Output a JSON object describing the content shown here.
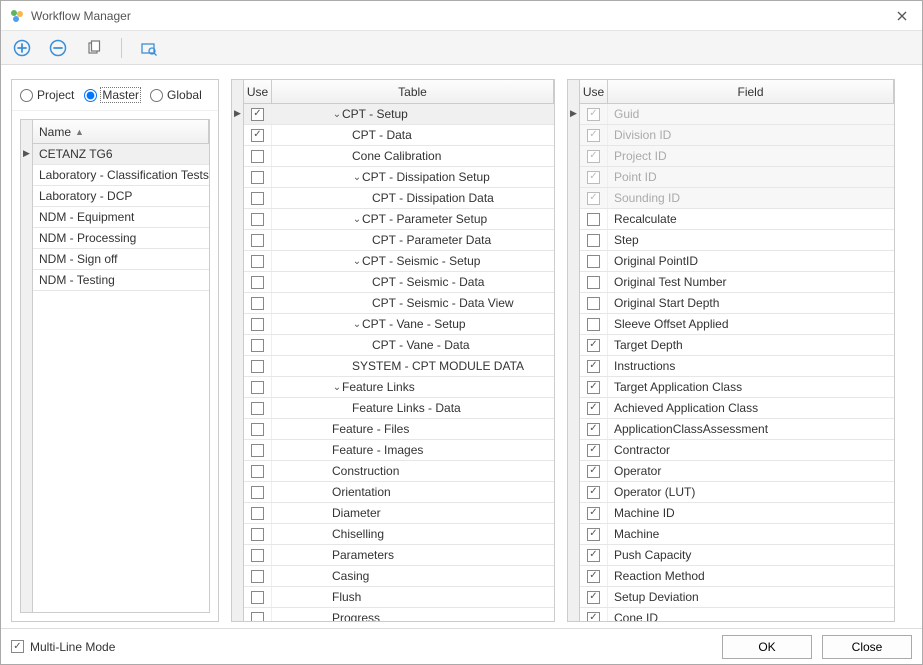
{
  "window": {
    "title": "Workflow Manager"
  },
  "toolbar": {
    "icons": [
      "add-icon",
      "remove-icon",
      "copy-icon",
      "inspect-icon"
    ]
  },
  "scope": {
    "options": [
      {
        "id": "project",
        "label": "Project",
        "checked": false
      },
      {
        "id": "master",
        "label": "Master",
        "checked": true
      },
      {
        "id": "global",
        "label": "Global",
        "checked": false
      }
    ]
  },
  "leftGrid": {
    "headers": {
      "name": "Name"
    },
    "rows": [
      {
        "name": "CETANZ TG6",
        "selected": true
      },
      {
        "name": "Laboratory - Classification Tests"
      },
      {
        "name": "Laboratory - DCP"
      },
      {
        "name": "NDM - Equipment"
      },
      {
        "name": "NDM - Processing"
      },
      {
        "name": "NDM - Sign off"
      },
      {
        "name": "NDM - Testing"
      }
    ]
  },
  "tableGrid": {
    "headers": {
      "use": "Use",
      "table": "Table"
    },
    "rows": [
      {
        "use": true,
        "label": "CPT - Setup",
        "indent": 0,
        "expand": true,
        "selected": true
      },
      {
        "use": true,
        "label": "CPT - Data",
        "indent": 1
      },
      {
        "use": false,
        "label": "Cone Calibration",
        "indent": 1
      },
      {
        "use": false,
        "label": "CPT - Dissipation Setup",
        "indent": 1,
        "expand": true
      },
      {
        "use": false,
        "label": "CPT - Dissipation Data",
        "indent": 2
      },
      {
        "use": false,
        "label": "CPT - Parameter Setup",
        "indent": 1,
        "expand": true
      },
      {
        "use": false,
        "label": "CPT - Parameter Data",
        "indent": 2
      },
      {
        "use": false,
        "label": "CPT - Seismic - Setup",
        "indent": 1,
        "expand": true
      },
      {
        "use": false,
        "label": "CPT - Seismic - Data",
        "indent": 2
      },
      {
        "use": false,
        "label": "CPT - Seismic - Data View",
        "indent": 2
      },
      {
        "use": false,
        "label": "CPT - Vane - Setup",
        "indent": 1,
        "expand": true
      },
      {
        "use": false,
        "label": "CPT - Vane - Data",
        "indent": 2
      },
      {
        "use": false,
        "label": "SYSTEM - CPT MODULE DATA",
        "indent": 1
      },
      {
        "use": false,
        "label": "Feature Links",
        "indent": 0,
        "expand": true
      },
      {
        "use": false,
        "label": "Feature Links - Data",
        "indent": 1
      },
      {
        "use": false,
        "label": "Feature - Files",
        "indent": 0
      },
      {
        "use": false,
        "label": "Feature - Images",
        "indent": 0
      },
      {
        "use": false,
        "label": "Construction",
        "indent": 0
      },
      {
        "use": false,
        "label": "Orientation",
        "indent": 0
      },
      {
        "use": false,
        "label": "Diameter",
        "indent": 0
      },
      {
        "use": false,
        "label": "Chiselling",
        "indent": 0
      },
      {
        "use": false,
        "label": "Parameters",
        "indent": 0
      },
      {
        "use": false,
        "label": "Casing",
        "indent": 0
      },
      {
        "use": false,
        "label": "Flush",
        "indent": 0
      },
      {
        "use": false,
        "label": "Progress",
        "indent": 0
      }
    ]
  },
  "fieldGrid": {
    "headers": {
      "use": "Use",
      "field": "Field"
    },
    "rows": [
      {
        "use": true,
        "label": "Guid",
        "muted": true
      },
      {
        "use": true,
        "label": "Division ID",
        "muted": true
      },
      {
        "use": true,
        "label": "Project ID",
        "muted": true
      },
      {
        "use": true,
        "label": "Point ID",
        "muted": true
      },
      {
        "use": true,
        "label": "Sounding ID",
        "muted": true
      },
      {
        "use": false,
        "label": "Recalculate"
      },
      {
        "use": false,
        "label": "Step"
      },
      {
        "use": false,
        "label": "Original PointID"
      },
      {
        "use": false,
        "label": "Original Test Number"
      },
      {
        "use": false,
        "label": "Original Start Depth"
      },
      {
        "use": false,
        "label": "Sleeve Offset Applied"
      },
      {
        "use": true,
        "label": "Target Depth"
      },
      {
        "use": true,
        "label": "Instructions"
      },
      {
        "use": true,
        "label": "Target Application Class"
      },
      {
        "use": true,
        "label": "Achieved Application Class"
      },
      {
        "use": true,
        "label": "ApplicationClassAssessment"
      },
      {
        "use": true,
        "label": "Contractor"
      },
      {
        "use": true,
        "label": "Operator"
      },
      {
        "use": true,
        "label": "Operator (LUT)"
      },
      {
        "use": true,
        "label": "Machine ID"
      },
      {
        "use": true,
        "label": "Machine"
      },
      {
        "use": true,
        "label": "Push Capacity"
      },
      {
        "use": true,
        "label": "Reaction Method"
      },
      {
        "use": true,
        "label": "Setup Deviation"
      },
      {
        "use": true,
        "label": "Cone ID"
      }
    ]
  },
  "footer": {
    "multiLine": {
      "label": "Multi-Line Mode",
      "checked": true
    },
    "ok": "OK",
    "close": "Close"
  }
}
